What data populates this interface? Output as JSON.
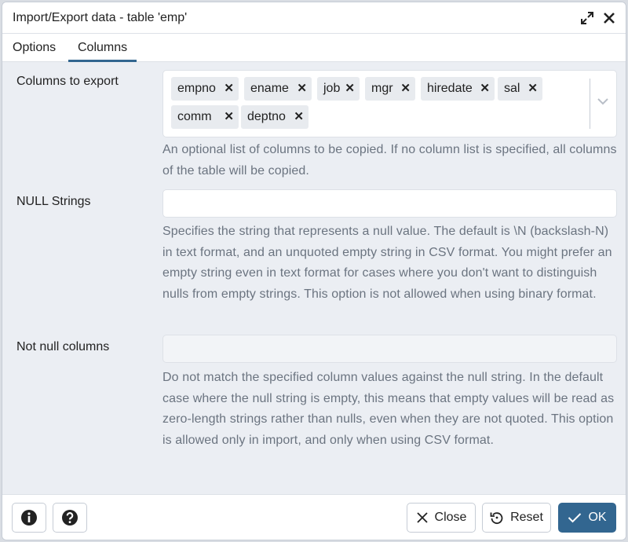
{
  "dialog": {
    "title": "Import/Export data - table 'emp'"
  },
  "tabs": [
    {
      "label": "Options",
      "active": false
    },
    {
      "label": "Columns",
      "active": true
    }
  ],
  "columns_to_export": {
    "label": "Columns to export",
    "tags": [
      "empno",
      "ename",
      "job",
      "mgr",
      "hiredate",
      "sal",
      "comm",
      "deptno"
    ],
    "help": "An optional list of columns to be copied. If no column list is specified, all columns of the table will be copied."
  },
  "null_strings": {
    "label": "NULL Strings",
    "value": "",
    "help": "Specifies the string that represents a null value. The default is \\N (backslash-N) in text format, and an unquoted empty string in CSV format. You might prefer an empty string even in text format for cases where you don't want to distinguish nulls from empty strings. This option is not allowed when using binary format."
  },
  "not_null_columns": {
    "label": "Not null columns",
    "value": "",
    "disabled": true,
    "help": "Do not match the specified column values against the null string. In the default case where the null string is empty, this means that empty values will be read as zero-length strings rather than nulls, even when they are not quoted. This option is allowed only in import, and only when using CSV format."
  },
  "footer": {
    "close_label": "Close",
    "reset_label": "Reset",
    "ok_label": "OK"
  },
  "colors": {
    "accent": "#326690",
    "help_text": "#6b7480",
    "background": "#ebeef3"
  },
  "icons": {
    "expand": "expand-icon",
    "close": "close-icon",
    "info": "info-icon",
    "help": "question-icon",
    "tag_remove": "x-icon",
    "dropdown": "chevron-down-icon",
    "reset": "undo-icon",
    "ok": "check-icon"
  }
}
